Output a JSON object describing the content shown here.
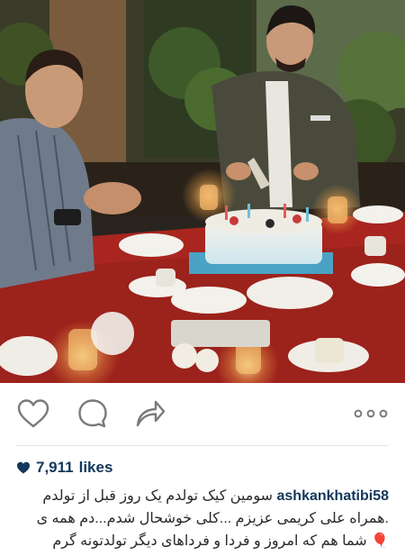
{
  "post": {
    "likes_count": "7,911",
    "likes_word": "likes",
    "username": "ashkankhatibi58",
    "caption_line1": "سومین کیک تولدم یک روز قبل از تولدم",
    "caption_line2": ".همراه علی کریمی عزیزم ...کلی خوشحال شدم...دم همه ی",
    "caption_line3": "شما هم که امروز و فردا و فرداهای دیگر تولدتونه گرم",
    "caption_emoji": "🎈"
  },
  "actions": {
    "like_icon": "heart-outline-icon",
    "comment_icon": "comment-bubble-icon",
    "share_icon": "share-arrow-icon",
    "more_icon": "more-dots-icon"
  },
  "colors": {
    "link": "#12375a",
    "text": "#262626",
    "icon": "#7a7a7a"
  }
}
